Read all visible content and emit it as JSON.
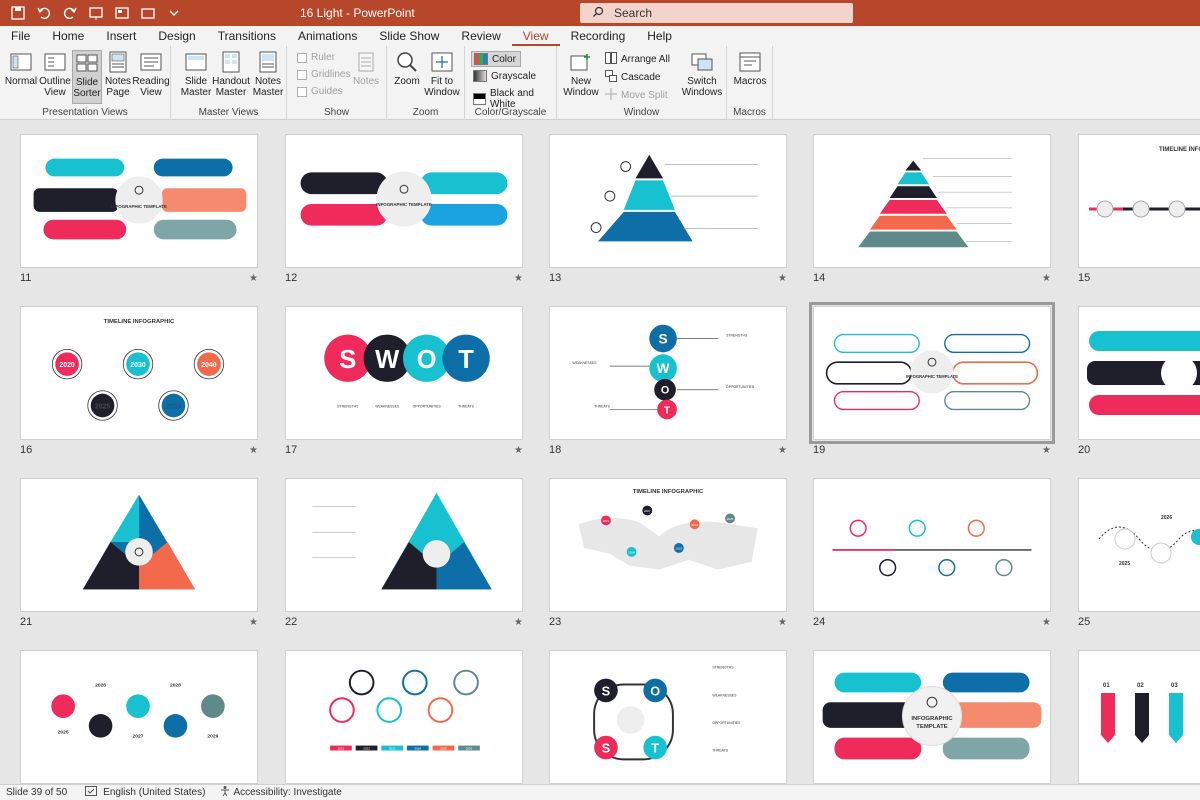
{
  "window": {
    "title": "16 Light  -  PowerPoint",
    "search_placeholder": "Search"
  },
  "menu": {
    "tabs": [
      "File",
      "Home",
      "Insert",
      "Design",
      "Transitions",
      "Animations",
      "Slide Show",
      "Review",
      "View",
      "Recording",
      "Help"
    ],
    "active": "View"
  },
  "ribbon": {
    "presentation_views": {
      "label": "Presentation Views",
      "normal": "Normal",
      "outline": "Outline View",
      "slide_sorter": "Slide Sorter",
      "notes_page": "Notes Page",
      "reading": "Reading View"
    },
    "master_views": {
      "label": "Master Views",
      "slide_master": "Slide Master",
      "handout_master": "Handout Master",
      "notes_master": "Notes Master"
    },
    "show": {
      "label": "Show",
      "ruler": "Ruler",
      "gridlines": "Gridlines",
      "guides": "Guides",
      "notes": "Notes"
    },
    "zoom": {
      "label": "Zoom",
      "zoom": "Zoom",
      "fit": "Fit to Window"
    },
    "color": {
      "label": "Color/Grayscale",
      "color": "Color",
      "grayscale": "Grayscale",
      "bw": "Black and White"
    },
    "window": {
      "label": "Window",
      "new": "New Window",
      "arrange": "Arrange All",
      "cascade": "Cascade",
      "move_split": "Move Split",
      "switch": "Switch Windows"
    },
    "macros": {
      "label": "Macros",
      "macros": "Macros"
    }
  },
  "slides": [
    {
      "num": "11"
    },
    {
      "num": "12"
    },
    {
      "num": "13"
    },
    {
      "num": "14"
    },
    {
      "num": "15"
    },
    {
      "num": "16"
    },
    {
      "num": "17"
    },
    {
      "num": "18"
    },
    {
      "num": "19"
    },
    {
      "num": "20"
    },
    {
      "num": "21"
    },
    {
      "num": "22"
    },
    {
      "num": "23"
    },
    {
      "num": "24"
    },
    {
      "num": "25"
    },
    {
      "num": ""
    },
    {
      "num": ""
    },
    {
      "num": ""
    },
    {
      "num": ""
    },
    {
      "num": ""
    }
  ],
  "slide_text": {
    "infographic_template": "INFOGRAPHIC TEMPLATE",
    "timeline_infographic": "TIMELINE INFOGRAPHIC",
    "swot": [
      "S",
      "W",
      "O",
      "T"
    ],
    "years_16": [
      "2020",
      "2030",
      "2040",
      "2025",
      "2035"
    ],
    "years_25": [
      "2026",
      "2025"
    ],
    "years_26": [
      "2026",
      "2028",
      "2025",
      "2027",
      "2029"
    ],
    "years_27": [
      "2021",
      "2022",
      "2023",
      "2024",
      "2025",
      "2026",
      "2027"
    ],
    "arrows_30": [
      "01",
      "02",
      "03"
    ],
    "swot_labels": [
      "STRENGTHS",
      "WEAKNESSES",
      "OPPORTUNITIES",
      "THREATS"
    ],
    "star": "★"
  },
  "status": {
    "slide": "Slide 39 of 50",
    "language": "English (United States)",
    "accessibility": "Accessibility: Investigate"
  },
  "colors": {
    "brand": "#b7472a",
    "cyan": "#17c1cf",
    "pink": "#ef2b5b",
    "dark": "#1e1f2b",
    "orange": "#f26a4b",
    "teal": "#5f8a8b",
    "blue": "#0e6ea8"
  }
}
